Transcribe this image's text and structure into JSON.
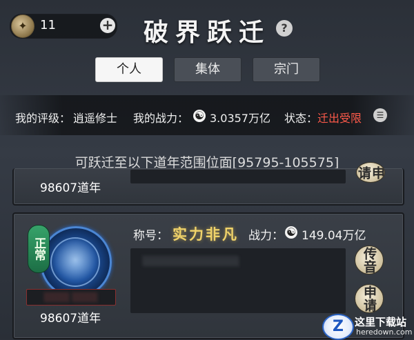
{
  "header": {
    "token_icon": "scroll-token-icon",
    "token_count": "11",
    "add_label": "+",
    "title": "破界跃迁",
    "help_label": "?"
  },
  "tabs": [
    {
      "label": "个人",
      "active": true
    },
    {
      "label": "集体",
      "active": false
    },
    {
      "label": "宗门",
      "active": false
    }
  ],
  "status_bar": {
    "rank_label": "我的评级：",
    "rank_value": "逍遥修士",
    "power_label": "我的战力：",
    "power_icon": "yinyang-icon",
    "power_value": "3.0357万亿",
    "state_label": "状态：",
    "state_value": "迁出受限",
    "state_color": "#ff5a4a",
    "list_icon": "list-icon"
  },
  "range_notice": "可跃迁至以下道年范围位面[95795-105575]",
  "cards": [
    {
      "year": "98607道年",
      "apply_label": "申请"
    },
    {
      "status_badge": "正常",
      "title_label": "称号：",
      "title_value": "实力非凡",
      "power_label": "战力：",
      "power_value": "149.04万亿",
      "year": "98607道年",
      "message_button": "传音",
      "apply_button": "申请"
    }
  ],
  "watermark": {
    "logo_letter": "Z",
    "name": "这里下载站",
    "url": "heredown.com"
  }
}
